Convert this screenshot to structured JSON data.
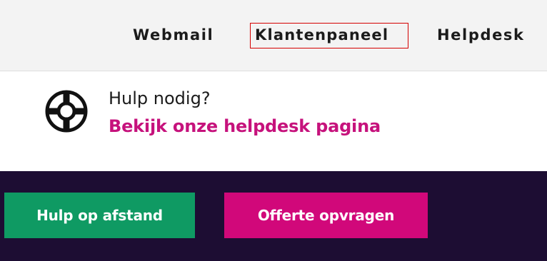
{
  "nav": {
    "items": [
      {
        "label": "Webmail"
      },
      {
        "label": "Klantenpaneel",
        "highlighted": true
      },
      {
        "label": "Helpdesk"
      }
    ],
    "highlight_color": "#d40000"
  },
  "help": {
    "icon": "lifebuoy-icon",
    "question": "Hulp nodig?",
    "link": "Bekijk onze helpdesk pagina",
    "link_color": "#c6127c"
  },
  "footer": {
    "background": "#1d0d33",
    "buttons": [
      {
        "label": "Hulp op afstand",
        "color": "#0f9a63"
      },
      {
        "label": "Offerte opvragen",
        "color": "#d1087a"
      }
    ]
  }
}
